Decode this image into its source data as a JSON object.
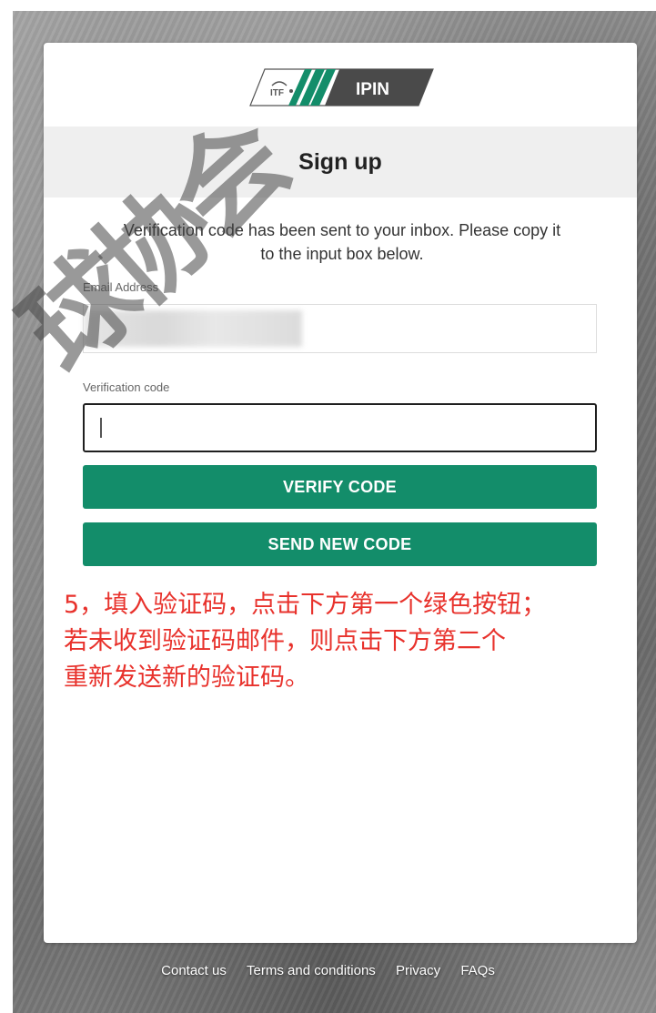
{
  "brand": {
    "logo_text": "IPIN",
    "logo_mark": "ITF",
    "colors": {
      "green": "#138d6a",
      "dark": "#444444",
      "annotation_red": "#e8322c"
    }
  },
  "header": {
    "title": "Sign up"
  },
  "form": {
    "intro_line1": "Verification code has been sent to your inbox. Please copy it",
    "intro_line2": "to the input box below.",
    "email_label": "Email Address",
    "code_label": "Verification code",
    "code_value": ""
  },
  "buttons": {
    "verify": "VERIFY CODE",
    "send_new": "SEND NEW CODE"
  },
  "annotation": {
    "line1": "5，填入验证码，点击下方第一个绿色按钮；",
    "line2": "若未收到验证码邮件，则点击下方第二个",
    "line3": "重新发送新的验证码。"
  },
  "footer": {
    "links": [
      "Contact us",
      "Terms and conditions",
      "Privacy",
      "FAQs"
    ]
  },
  "watermark": {
    "text": "球协会"
  }
}
